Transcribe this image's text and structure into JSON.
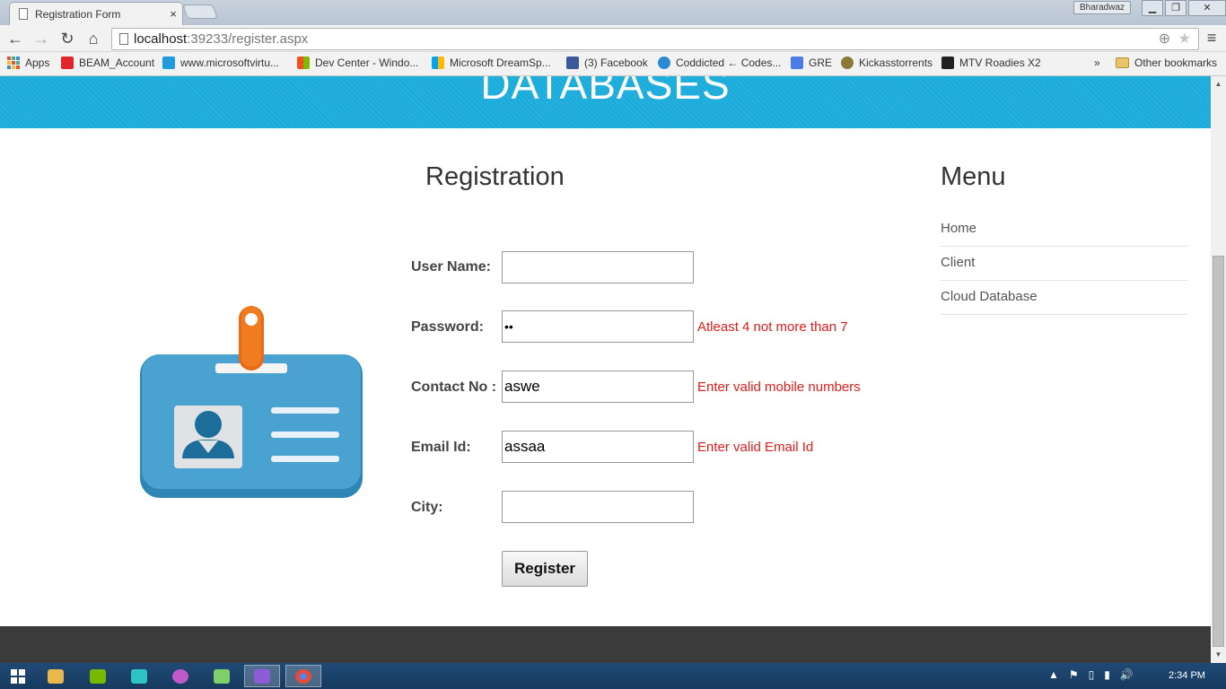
{
  "browser": {
    "tab_title": "Registration Form",
    "tab_close": "×",
    "profile_name": "Bharadwaz",
    "window_buttons": {
      "minimize": "▁",
      "maximize": "❐",
      "close": "✕"
    },
    "url_host": "localhost",
    "url_rest": ":39233/register.aspx",
    "nav": {
      "back": "←",
      "forward": "→",
      "reload": "↻",
      "home": "⌂",
      "menu": "≡"
    },
    "omnibox_icons": {
      "zoom": "⊕",
      "star": "★"
    },
    "bookmarks": [
      {
        "label": "Apps"
      },
      {
        "label": "BEAM_Account",
        "color": "#e0252b"
      },
      {
        "label": "www.microsoftvirtu...",
        "color": "#1f9bde"
      },
      {
        "label": "Dev Center - Windo...",
        "color": "#f25022"
      },
      {
        "label": "Microsoft DreamSp...",
        "color": "#7fba00"
      },
      {
        "label": "(3) Facebook",
        "color": "#3b5998"
      },
      {
        "label": "Coddicted ← Codes...",
        "color": "#2a8ad4"
      },
      {
        "label": "GRE",
        "color": "#4a7be6"
      },
      {
        "label": "Kickasstorrents",
        "color": "#8a7a3a"
      },
      {
        "label": "MTV Roadies X2",
        "color": "#222222"
      }
    ],
    "bookmarks_overflow": "»",
    "other_bookmarks": "Other bookmarks"
  },
  "page": {
    "banner_title": "DATABASES",
    "registration_heading": "Registration",
    "menu_heading": "Menu",
    "menu_items": [
      "Home",
      "Client",
      "Cloud Database"
    ],
    "form": {
      "username_label": "User Name:",
      "username_value": "",
      "password_label": "Password:",
      "password_value": "••",
      "password_error": "Atleast 4 not more than 7",
      "contact_label": "Contact No :",
      "contact_value": "aswe",
      "contact_error": "Enter valid mobile numbers",
      "email_label": "Email Id:",
      "email_value": "assaa",
      "email_error": "Enter valid Email Id",
      "city_label": "City:",
      "city_value": "",
      "register_button": "Register"
    },
    "colors": {
      "banner": "#1eaad8",
      "error": "#e31b1b",
      "footer": "#3b3b3b"
    }
  },
  "taskbar": {
    "apps": [
      {
        "name": "start-icon",
        "color": "#ffffff"
      },
      {
        "name": "file-explorer-icon",
        "color": "#e8b84a"
      },
      {
        "name": "nvidia-icon",
        "color": "#76b900"
      },
      {
        "name": "app-cube-icon",
        "color": "#2fc4c4"
      },
      {
        "name": "firefox-icon",
        "color": "#c05ac8"
      },
      {
        "name": "folders-icon",
        "color": "#7fcf6a"
      },
      {
        "name": "visual-studio-icon",
        "color": "#8e5bd6"
      },
      {
        "name": "chrome-icon",
        "color": "#e54b3c"
      }
    ],
    "tray_icons": [
      "▲",
      "⚑",
      "▯",
      "▮",
      "🔊"
    ],
    "clock": "2:34 PM"
  }
}
